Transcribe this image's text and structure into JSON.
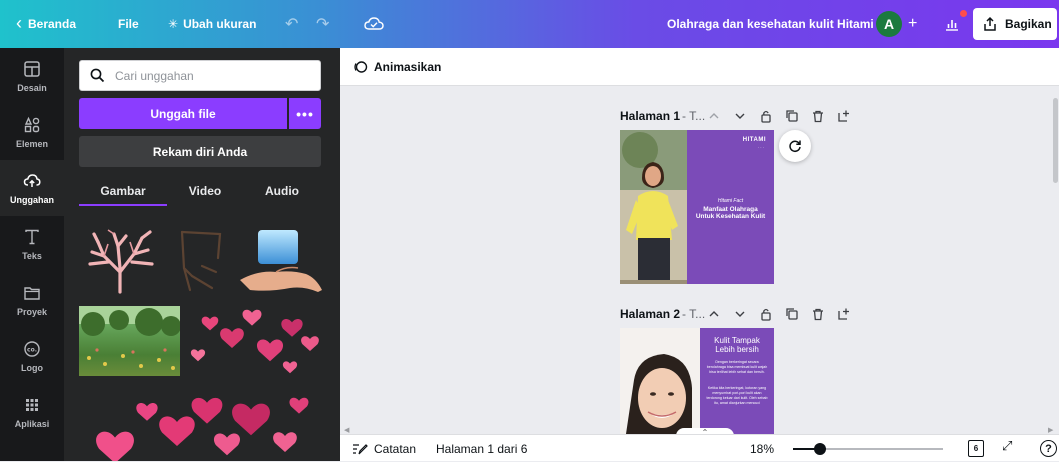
{
  "topbar": {
    "back_label": "Beranda",
    "file_label": "File",
    "resize_label": "Ubah ukuran",
    "doc_title": "Olahraga dan kesehatan kulit Hitami",
    "avatar_initial": "A",
    "share_label": "Bagikan"
  },
  "rail": {
    "items": [
      {
        "label": "Desain",
        "icon": "layout-icon"
      },
      {
        "label": "Elemen",
        "icon": "shapes-icon"
      },
      {
        "label": "Unggahan",
        "icon": "cloud-upload-icon"
      },
      {
        "label": "Teks",
        "icon": "text-icon"
      },
      {
        "label": "Proyek",
        "icon": "folder-icon"
      },
      {
        "label": "Logo",
        "icon": "logo-icon"
      },
      {
        "label": "Aplikasi",
        "icon": "apps-grid-icon"
      }
    ],
    "active_index": 2
  },
  "panel": {
    "search_placeholder": "Cari unggahan",
    "upload_label": "Unggah file",
    "more_label": "•••",
    "record_label": "Rekam diri Anda",
    "tabs": [
      "Gambar",
      "Video",
      "Audio"
    ],
    "active_tab": 0
  },
  "editor": {
    "animate_label": "Animasikan",
    "pages": [
      {
        "label": "Halaman 1",
        "subtitle": "- T...",
        "brand": "HITAMI",
        "brand_sub": "· · ·",
        "kicker": "Hitami Fact",
        "title_lines": [
          "Manfaat Olahraga",
          "Untuk Kesehatan Kulit"
        ]
      },
      {
        "label": "Halaman 2",
        "subtitle": "- T...",
        "title_lines": [
          "Kulit Tampak",
          "Lebih bersih"
        ],
        "body1": "Dengan berkeringat secara berolahraga bisa membuat kulit wajah bisa terlihat lebih sehat dan bersih.",
        "body2": "Ketika kita berkeringat, kotoran yang menyumbat pori-pori kulit akan terdorong keluar dari kulit. Oleh sebab itu, amat dianjurkan mencuci"
      }
    ]
  },
  "footer": {
    "notes_label": "Catatan",
    "page_indicator": "Halaman 1 dari 6",
    "zoom": "18%",
    "zoom_fraction": 0.18,
    "grid_count": "6",
    "help_label": "?"
  },
  "colors": {
    "brand_purple": "#8b3dff",
    "design_purple": "#7b4bb8",
    "panel_bg": "#252627",
    "rail_bg": "#18191b"
  }
}
